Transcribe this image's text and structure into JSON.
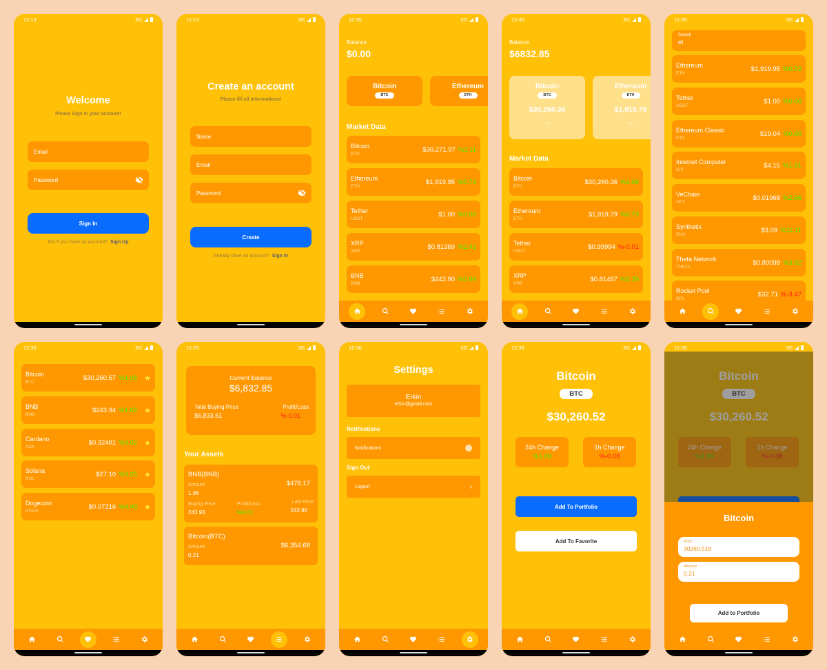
{
  "nav_icons": [
    "home-icon",
    "search-icon",
    "heart-icon",
    "list-icon",
    "gear-icon"
  ],
  "status": {
    "network": "3G",
    "times": [
      "12:13",
      "12:13",
      "12:35",
      "12:40",
      "12:35",
      "12:36",
      "12:29",
      "12:36",
      "12:38",
      "12:38"
    ]
  },
  "login": {
    "title": "Welcome",
    "subtitle": "Please Sign in your account!",
    "email": "Email",
    "password": "Password",
    "button": "Sign In",
    "footer": "Don't you have an account?",
    "footer_link": "Sign Up"
  },
  "register": {
    "title": "Create an account",
    "subtitle": "Please fill all informations!",
    "name": "Name",
    "email": "Email",
    "password": "Password",
    "button": "Create",
    "footer": "Already have an account?",
    "footer_link": "Sign In"
  },
  "home1": {
    "balance_label": "Balance",
    "balance": "$0.00",
    "holdings": [
      {
        "name": "Bitcoin",
        "sym": "BTC"
      },
      {
        "name": "Ethereum",
        "sym": "ETH"
      }
    ],
    "section": "Market Data",
    "coins": [
      {
        "name": "Bitcoin",
        "sym": "BTC",
        "price": "$30,271.97",
        "chg": "%1.11",
        "up": true
      },
      {
        "name": "Ethereum",
        "sym": "ETH",
        "price": "$1,919.95",
        "chg": "%0.72",
        "up": true
      },
      {
        "name": "Tether",
        "sym": "USDT",
        "price": "$1.00",
        "chg": "%0.00",
        "up": true
      },
      {
        "name": "XRP",
        "sym": "XRP",
        "price": "$0.81369",
        "chg": "%2.42",
        "up": true
      },
      {
        "name": "BNB",
        "sym": "BNB",
        "price": "$243.90",
        "chg": "%0.99",
        "up": true
      }
    ]
  },
  "home2": {
    "balance_label": "Balance",
    "balance": "$6832.85",
    "holdings": [
      {
        "name": "Bitcoin",
        "sym": "BTC",
        "price": "$30,260.36"
      },
      {
        "name": "Ethereum",
        "sym": "ETH",
        "price": "$1,919.79"
      }
    ],
    "section": "Market Data",
    "coins": [
      {
        "name": "Bitcoin",
        "sym": "BTC",
        "price": "$30,260.36",
        "chg": "%1.08",
        "up": true
      },
      {
        "name": "Ethereum",
        "sym": "ETH",
        "price": "$1,919.79",
        "chg": "%0.73",
        "up": true
      },
      {
        "name": "Tether",
        "sym": "USDT",
        "price": "$0.99994",
        "chg": "%-0.01",
        "up": false
      },
      {
        "name": "XRP",
        "sym": "XRP",
        "price": "$0.81487",
        "chg": "%2.39",
        "up": true
      }
    ]
  },
  "search": {
    "label": "Search",
    "value": "et",
    "coins": [
      {
        "name": "Ethereum",
        "sym": "ETH",
        "price": "$1,919.95",
        "chg": "%0.72",
        "up": true
      },
      {
        "name": "Tether",
        "sym": "USDT",
        "price": "$1.00",
        "chg": "%0.00",
        "up": true
      },
      {
        "name": "Ethereum Classic",
        "sym": "ETC",
        "price": "$19.04",
        "chg": "%0.80",
        "up": true
      },
      {
        "name": "Internet Computer",
        "sym": "ICP",
        "price": "$4.15",
        "chg": "%1.61",
        "up": true
      },
      {
        "name": "VeChain",
        "sym": "VET",
        "price": "$0.01968",
        "chg": "%2.66",
        "up": true
      },
      {
        "name": "Synthetix",
        "sym": "SNX",
        "price": "$3.09",
        "chg": "%11.11",
        "up": true
      },
      {
        "name": "Theta Network",
        "sym": "THETA",
        "price": "$0.80099",
        "chg": "%3.82",
        "up": true
      },
      {
        "name": "Rocket Pool",
        "sym": "RPL",
        "price": "$32.71",
        "chg": "%-3.47",
        "up": false
      }
    ]
  },
  "favorites": {
    "coins": [
      {
        "name": "Bitcoin",
        "sym": "BTC",
        "price": "$30,260.57",
        "chg": "%1.06",
        "up": true
      },
      {
        "name": "BNB",
        "sym": "BNB",
        "price": "$243.94",
        "chg": "%1.02",
        "up": true
      },
      {
        "name": "Cardano",
        "sym": "ADA",
        "price": "$0.32481",
        "chg": "%3.02",
        "up": true
      },
      {
        "name": "Solana",
        "sym": "SOL",
        "price": "$27.10",
        "chg": "%3.25",
        "up": true
      },
      {
        "name": "Dogecoin",
        "sym": "DOGE",
        "price": "$0.07216",
        "chg": "%4.49",
        "up": true
      }
    ]
  },
  "portfolio": {
    "current_label": "Current Balance",
    "current": "$6,832.85",
    "buying_label": "Total Buying Price",
    "buying": "$6,833.61",
    "pl_label": "Profit/Loss",
    "pl": "%-0.01",
    "section": "Your Assets",
    "asset1": {
      "name": "BNB",
      "sym": "(BNB)",
      "amount_label": "Amount",
      "amount": "1.96",
      "value": "$478.17",
      "buy_label": "Buying Price",
      "buy": "243.93",
      "pl_label": "Profit/Loss",
      "pl": "%0.01",
      "last_label": "Last Price",
      "last": "243.96"
    },
    "asset2": {
      "name": "Bitcoin",
      "sym": "(BTC)",
      "amount_label": "Amount",
      "amount": "0.21",
      "value": "$6,354.68"
    }
  },
  "settings": {
    "title": "Settings",
    "user": "Erkin",
    "email": "erkin@gmail.com",
    "notif_section": "Notifications",
    "notif_item": "Notifications",
    "signout_section": "Sign Out",
    "logout": "Logout"
  },
  "detail": {
    "name": "Bitcoin",
    "sym": "BTC",
    "price": "$30,260.52",
    "c24_label": "24h Change",
    "c24": "%1.09",
    "c1_label": "1h Change",
    "c1": "%-0.08",
    "add_portfolio": "Add To Portfolio",
    "add_favorite": "Add To Favorite"
  },
  "sheet": {
    "title": "Bitcoin",
    "price_label": "Price",
    "price": "30260.518",
    "amount_label": "Amount",
    "amount": "0.21",
    "button": "Add to Portfolio"
  },
  "colors": {
    "bg": "#f8d3b4",
    "screen": "#ffc107",
    "card": "#ff9800",
    "blue": "#0a6cff",
    "green": "#44ee00",
    "red": "#ff1a1a"
  }
}
